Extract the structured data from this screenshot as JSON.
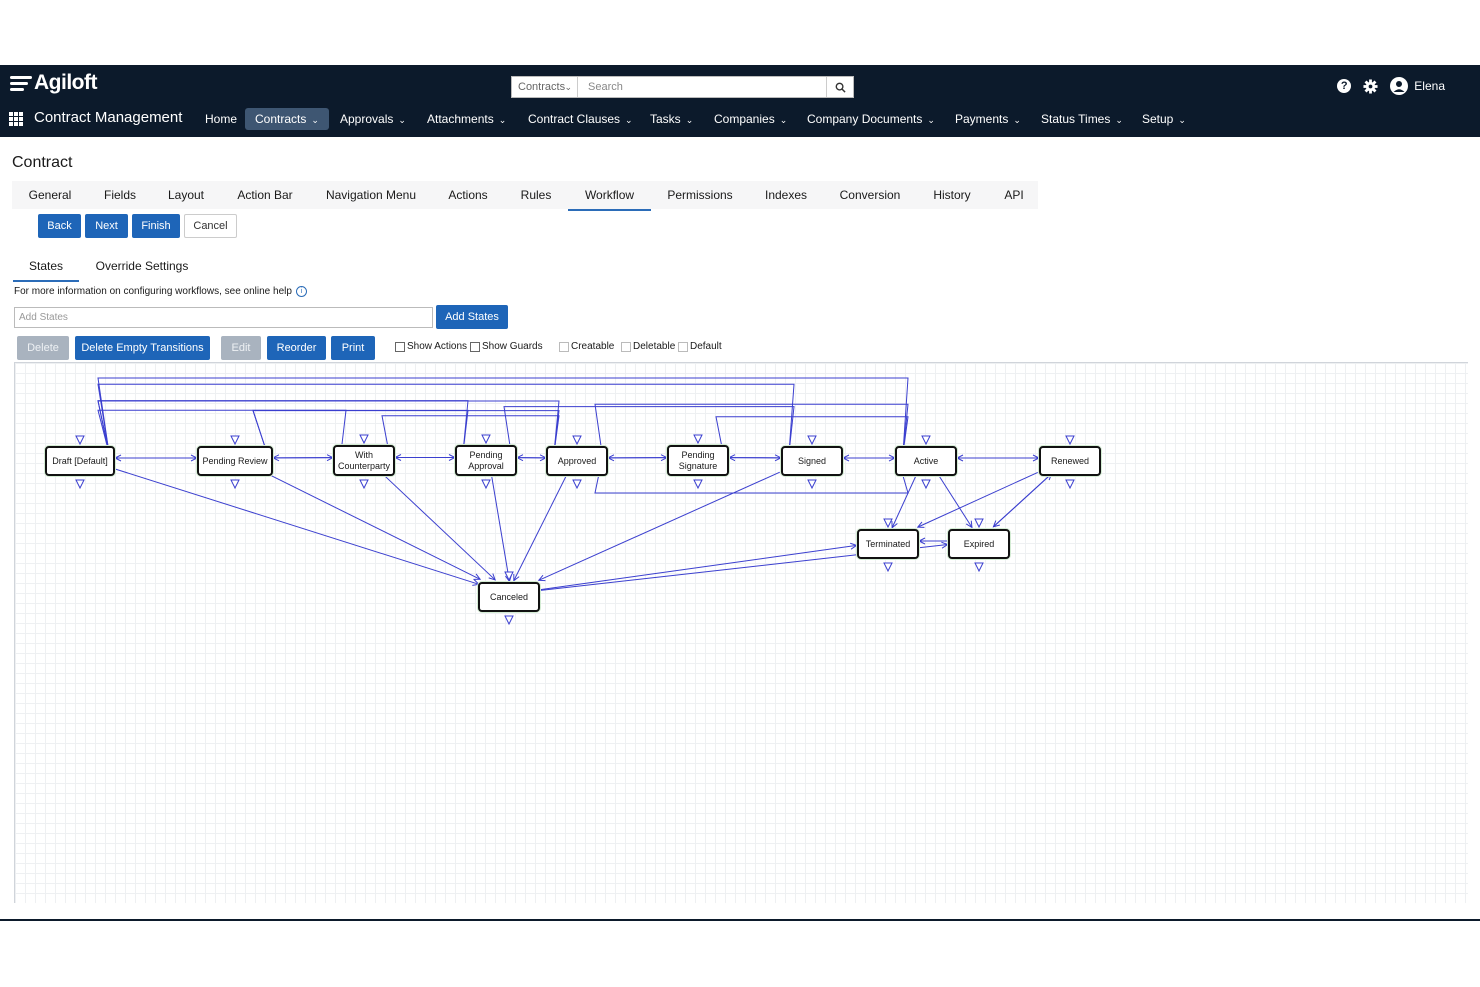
{
  "header": {
    "logo_text": "Agiloft",
    "search_scope": "Contracts",
    "search_placeholder": "Search",
    "user_name": "Elena",
    "app_title": "Contract Management",
    "nav": [
      "Home",
      "Contracts",
      "Approvals",
      "Attachments",
      "Contract Clauses",
      "Tasks",
      "Companies",
      "Company Documents",
      "Payments",
      "Status Times",
      "Setup"
    ],
    "active_nav": "Contracts"
  },
  "page": {
    "title": "Contract",
    "tabs": [
      "General",
      "Fields",
      "Layout",
      "Action Bar",
      "Navigation Menu",
      "Actions",
      "Rules",
      "Workflow",
      "Permissions",
      "Indexes",
      "Conversion",
      "History",
      "API"
    ],
    "active_tab": "Workflow"
  },
  "wizard": {
    "back": "Back",
    "next": "Next",
    "finish": "Finish",
    "cancel": "Cancel"
  },
  "subtabs": {
    "states": "States",
    "override": "Override Settings"
  },
  "help_text": "For more information on configuring workflows, see online help",
  "add_states": {
    "placeholder": "Add States",
    "button": "Add States"
  },
  "toolbar": {
    "delete": "Delete",
    "delete_empty": "Delete Empty Transitions",
    "edit": "Edit",
    "reorder": "Reorder",
    "print": "Print",
    "show_actions": "Show Actions",
    "show_guards": "Show Guards",
    "creatable": "Creatable",
    "deletable": "Deletable",
    "default": "Default"
  },
  "workflow": {
    "states": [
      {
        "id": "draft",
        "label": "Draft [Default]"
      },
      {
        "id": "review",
        "label": "Pending Review"
      },
      {
        "id": "counterparty",
        "label": "With Counterparty"
      },
      {
        "id": "approval",
        "label": "Pending Approval"
      },
      {
        "id": "approved",
        "label": "Approved"
      },
      {
        "id": "signature",
        "label": "Pending Signature"
      },
      {
        "id": "signed",
        "label": "Signed"
      },
      {
        "id": "active",
        "label": "Active"
      },
      {
        "id": "renewed",
        "label": "Renewed"
      },
      {
        "id": "terminated",
        "label": "Terminated"
      },
      {
        "id": "expired",
        "label": "Expired"
      },
      {
        "id": "canceled",
        "label": "Canceled"
      }
    ],
    "transitions": [
      [
        "draft",
        "review"
      ],
      [
        "review",
        "draft"
      ],
      [
        "review",
        "counterparty"
      ],
      [
        "counterparty",
        "review"
      ],
      [
        "counterparty",
        "approval"
      ],
      [
        "approval",
        "counterparty"
      ],
      [
        "approval",
        "approved"
      ],
      [
        "approved",
        "approval"
      ],
      [
        "approved",
        "signature"
      ],
      [
        "signature",
        "approved"
      ],
      [
        "signature",
        "signed"
      ],
      [
        "signed",
        "signature"
      ],
      [
        "signed",
        "active"
      ],
      [
        "active",
        "signed"
      ],
      [
        "active",
        "renewed"
      ],
      [
        "renewed",
        "active"
      ],
      [
        "active",
        "terminated"
      ],
      [
        "active",
        "expired"
      ],
      [
        "expired",
        "terminated"
      ],
      [
        "renewed",
        "expired"
      ],
      [
        "expired",
        "renewed"
      ],
      [
        "renewed",
        "terminated"
      ],
      [
        "draft",
        "canceled"
      ],
      [
        "review",
        "canceled"
      ],
      [
        "counterparty",
        "canceled"
      ],
      [
        "approval",
        "canceled"
      ],
      [
        "approved",
        "canceled"
      ],
      [
        "signed",
        "canceled"
      ],
      [
        "canceled",
        "terminated"
      ],
      [
        "canceled",
        "expired"
      ],
      [
        "draft",
        "counterparty"
      ],
      [
        "draft",
        "approval"
      ],
      [
        "draft",
        "approved"
      ],
      [
        "draft",
        "signed"
      ],
      [
        "draft",
        "active"
      ],
      [
        "review",
        "approval"
      ],
      [
        "review",
        "approved"
      ],
      [
        "counterparty",
        "approved"
      ],
      [
        "approval",
        "signed"
      ],
      [
        "approved",
        "active"
      ],
      [
        "signature",
        "active"
      ],
      [
        "active",
        "approved"
      ]
    ]
  }
}
